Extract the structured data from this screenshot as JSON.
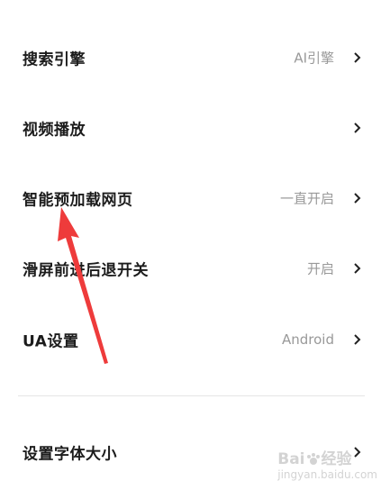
{
  "settings": {
    "items": [
      {
        "label": "搜索引擎",
        "value": "AI引擎"
      },
      {
        "label": "视频播放",
        "value": ""
      },
      {
        "label": "智能预加载网页",
        "value": "一直开启"
      },
      {
        "label": "滑屏前进后退开关",
        "value": "开启"
      },
      {
        "label": "UA设置",
        "value": "Android"
      },
      {
        "label": "设置字体大小",
        "value": ""
      }
    ]
  },
  "watermark": {
    "brand": "Bai",
    "brand2": "经验",
    "domain": "jingyan.baidu.com"
  },
  "colors": {
    "annotation_arrow": "#ee3b3b",
    "label": "#1c1c1c",
    "value": "#999999"
  },
  "icons": {
    "chevron": "chevron-right-icon",
    "paw": "paw-icon"
  }
}
